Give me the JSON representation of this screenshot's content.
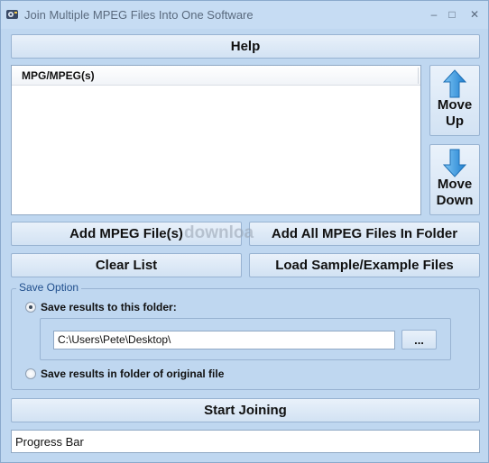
{
  "window": {
    "title": "Join Multiple MPEG Files Into One Software",
    "minimize_glyph": "–",
    "maximize_glyph": "□",
    "close_glyph": "✕"
  },
  "help_label": "Help",
  "file_list": {
    "column_header": "MPG/MPEG(s)",
    "items": []
  },
  "move_up": {
    "line1": "Move",
    "line2": "Up",
    "icon": "arrow-up-icon"
  },
  "move_down": {
    "line1": "Move",
    "line2": "Down",
    "icon": "arrow-down-icon"
  },
  "buttons": {
    "add_files": "Add MPEG File(s)",
    "add_folder": "Add All MPEG Files In Folder",
    "clear_list": "Clear List",
    "load_sample": "Load Sample/Example Files",
    "browse": "...",
    "start": "Start Joining"
  },
  "save_option": {
    "legend": "Save Option",
    "option_folder": "Save results to this folder:",
    "option_original": "Save results in folder of original file",
    "selected": "option_folder",
    "folder_path": "C:\\Users\\Pete\\Desktop\\"
  },
  "progress_label": "Progress Bar",
  "watermark": "downloa",
  "colors": {
    "window_bg": "#bfd7f0",
    "arrow_blue": "#2e8fd6",
    "legend_text": "#1f4e8c"
  }
}
